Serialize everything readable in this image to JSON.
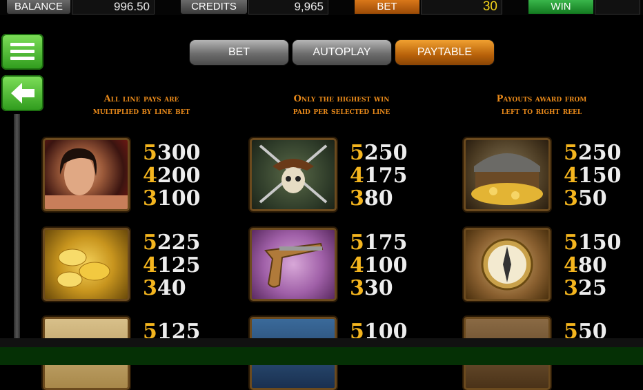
{
  "topbar": {
    "balance_label": "BALANCE",
    "balance_value": "996.50",
    "credits_label": "CREDITS",
    "credits_value": "9,965",
    "bet_label": "BET",
    "bet_value": "30",
    "win_label": "WIN",
    "win_value": ""
  },
  "sidebar": {
    "menu_icon": "hamburger-menu-icon",
    "back_icon": "arrow-left-icon"
  },
  "tabs": [
    {
      "label": "BET",
      "active": false
    },
    {
      "label": "AUTOPLAY",
      "active": false
    },
    {
      "label": "PAYTABLE",
      "active": true
    }
  ],
  "headers": [
    {
      "line1": "All line pays are",
      "line2": "multiplied by line bet"
    },
    {
      "line1": "Only the highest win",
      "line2": "paid per selected line"
    },
    {
      "line1": "Payouts award from",
      "line2": "left to right reel"
    }
  ],
  "symbols": [
    {
      "name": "pirate-woman-symbol",
      "pays": [
        {
          "count": "5",
          "value": "300"
        },
        {
          "count": "4",
          "value": "200"
        },
        {
          "count": "3",
          "value": "100"
        }
      ]
    },
    {
      "name": "skull-crossed-swords-symbol",
      "pays": [
        {
          "count": "5",
          "value": "250"
        },
        {
          "count": "4",
          "value": "175"
        },
        {
          "count": "3",
          "value": "80"
        }
      ]
    },
    {
      "name": "treasure-chest-symbol",
      "pays": [
        {
          "count": "5",
          "value": "250"
        },
        {
          "count": "4",
          "value": "150"
        },
        {
          "count": "3",
          "value": "50"
        }
      ]
    },
    {
      "name": "gold-coins-symbol",
      "pays": [
        {
          "count": "5",
          "value": "225"
        },
        {
          "count": "4",
          "value": "125"
        },
        {
          "count": "3",
          "value": "40"
        }
      ]
    },
    {
      "name": "flintlock-pistol-symbol",
      "pays": [
        {
          "count": "5",
          "value": "175"
        },
        {
          "count": "4",
          "value": "100"
        },
        {
          "count": "3",
          "value": "30"
        }
      ]
    },
    {
      "name": "compass-symbol",
      "pays": [
        {
          "count": "5",
          "value": "150"
        },
        {
          "count": "4",
          "value": "80"
        },
        {
          "count": "3",
          "value": "25"
        }
      ]
    },
    {
      "name": "treasure-map-symbol",
      "pays": [
        {
          "count": "5",
          "value": "125"
        }
      ]
    },
    {
      "name": "cannon-symbol",
      "pays": [
        {
          "count": "5",
          "value": "100"
        }
      ]
    },
    {
      "name": "barrels-symbol",
      "pays": [
        {
          "count": "5",
          "value": "50"
        }
      ]
    }
  ]
}
